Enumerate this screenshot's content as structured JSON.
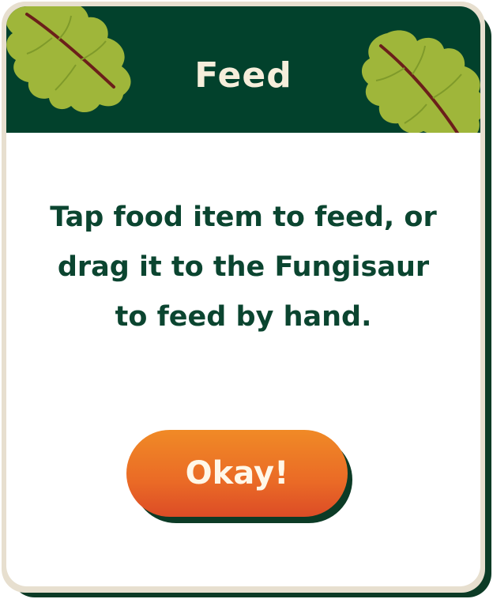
{
  "dialog": {
    "title": "Feed",
    "message": "Tap food item to feed, or drag it to the Fungisaur to feed by hand.",
    "button_label": "Okay!"
  },
  "icons": {
    "left_decoration": "leaf-icon",
    "right_decoration": "leaf-icon"
  },
  "colors": {
    "header_bg": "#02412c",
    "title_text": "#f6eedb",
    "message_text": "#0b4530",
    "button_top": "#f08a26",
    "button_bottom": "#dc4c26",
    "leaf_green": "#9fb63a",
    "leaf_vein": "#6b1f1a"
  }
}
